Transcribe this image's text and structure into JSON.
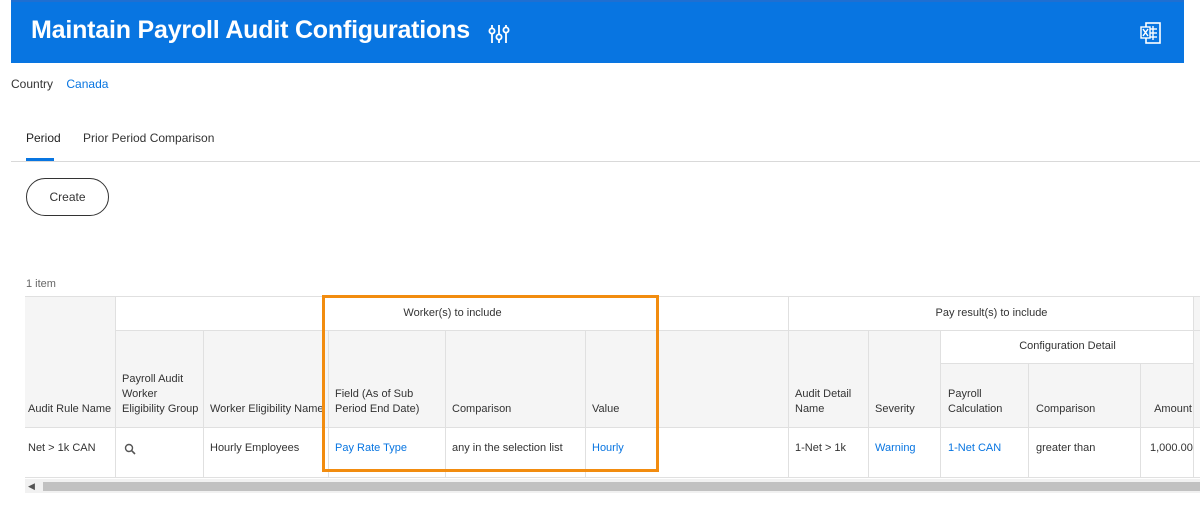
{
  "header": {
    "title": "Maintain Payroll Audit Configurations",
    "related_actions_icon": "sliders-icon",
    "export_icon": "excel-export-icon",
    "bg_color": "#0875e1"
  },
  "country": {
    "label": "Country",
    "value": "Canada"
  },
  "tabs": [
    {
      "label": "Period",
      "active": true
    },
    {
      "label": "Prior Period Comparison",
      "active": false
    }
  ],
  "create_button": {
    "label": "Create"
  },
  "item_count": "1 item",
  "table": {
    "groups": {
      "workers": "Worker(s) to include",
      "pay_results": "Pay result(s) to include",
      "config_detail": "Configuration Detail"
    },
    "columns": [
      "Audit Rule Name",
      "Payroll Audit Worker Eligibility Group",
      "Worker Eligibility Name",
      "Field (As of Sub Period End Date)",
      "Comparison",
      "Value",
      "Audit Detail Name",
      "Severity",
      "Payroll Calculation",
      "Comparison",
      "Amount"
    ],
    "rows": [
      {
        "audit_rule_name": "Net > 1k CAN",
        "eligibility_group_icon": "search-icon",
        "worker_eligibility_name": "Hourly Employees",
        "field": "Pay Rate Type",
        "comparison": "any in the selection list",
        "value": "Hourly",
        "audit_detail_name": "1-Net > 1k",
        "severity": "Warning",
        "payroll_calculation": "1-Net CAN",
        "pay_comparison": "greater than",
        "amount": "1,000.00"
      }
    ]
  },
  "highlight_color": "#f28c0f"
}
